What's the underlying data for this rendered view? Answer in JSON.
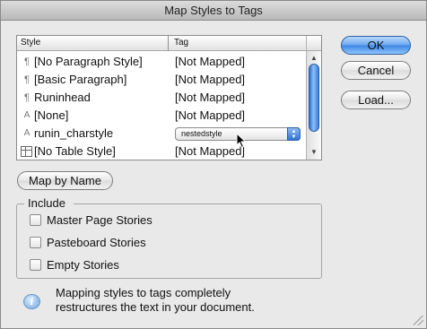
{
  "window": {
    "title": "Map Styles to Tags"
  },
  "table": {
    "headers": {
      "style": "Style",
      "tag": "Tag"
    },
    "rows": [
      {
        "icon": "paragraph-style-icon",
        "glyph": "¶",
        "style": "[No Paragraph Style]",
        "tag": "[Not Mapped]"
      },
      {
        "icon": "paragraph-style-icon",
        "glyph": "¶",
        "style": "[Basic Paragraph]",
        "tag": "[Not Mapped]"
      },
      {
        "icon": "paragraph-style-icon",
        "glyph": "¶",
        "style": "Runinhead",
        "tag": "[Not Mapped]"
      },
      {
        "icon": "character-style-icon",
        "glyph": "A",
        "style": "[None]",
        "tag": "[Not Mapped]"
      },
      {
        "icon": "character-style-icon",
        "glyph": "A",
        "style": "runin_charstyle",
        "tag": "nestedstyle"
      },
      {
        "icon": "table-style-icon",
        "glyph": "",
        "style": "[No Table Style]",
        "tag": "[Not Mapped]"
      }
    ]
  },
  "buttons": {
    "ok": "OK",
    "cancel": "Cancel",
    "load": "Load...",
    "map_by_name": "Map by Name"
  },
  "include": {
    "label": "Include",
    "options": [
      {
        "label": "Master Page Stories",
        "checked": false
      },
      {
        "label": "Pasteboard Stories",
        "checked": false
      },
      {
        "label": "Empty Stories",
        "checked": false
      }
    ]
  },
  "info": {
    "line1": "Mapping styles to tags completely",
    "line2": "restructures the text in your document."
  },
  "colors": {
    "accent": "#3b86e5",
    "dialog_bg": "#e9e9e9"
  }
}
